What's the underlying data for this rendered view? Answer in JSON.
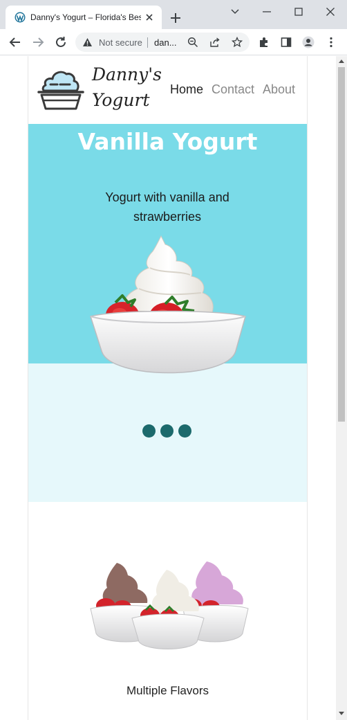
{
  "browser": {
    "tab_title": "Danny's Yogurt – Florida's Best",
    "omnibox_security": "Not secure",
    "omnibox_url": "dan...",
    "icons": [
      "wordpress-icon",
      "close-icon",
      "plus-icon",
      "back-icon",
      "forward-icon",
      "reload-icon",
      "warning-icon",
      "zoom-out-icon",
      "share-icon",
      "star-icon",
      "extensions-icon",
      "side-panel-icon",
      "profile-icon",
      "minimize-icon",
      "maximize-icon",
      "window-close-icon",
      "chevron-down-icon"
    ]
  },
  "site": {
    "brand": "Danny's Yogurt",
    "nav": {
      "home": "Home",
      "contact": "Contact",
      "about": "About"
    },
    "hero": {
      "title": "Vanilla Yogurt",
      "subtitle": "Yogurt with vanilla and strawberries",
      "background": "#7adbe8",
      "lower_background": "#e6f8fb"
    },
    "carousel": {
      "dot_count": 3,
      "dot_color": "#1c6a6c"
    },
    "feature": {
      "caption": "Multiple Flavors"
    }
  }
}
